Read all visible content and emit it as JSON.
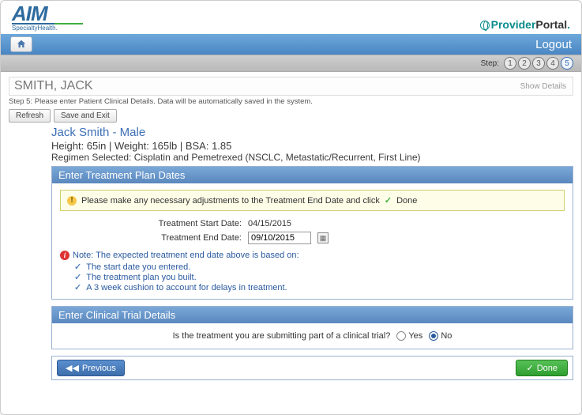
{
  "branding": {
    "aim_main": "AIM",
    "aim_sub": "SpecialtyHealth.",
    "pp_1": "Provider",
    "pp_2": "Portal",
    "pp_dot": "."
  },
  "nav": {
    "logout": "Logout"
  },
  "steps": {
    "label": "Step:",
    "items": [
      "1",
      "2",
      "3",
      "4",
      "5"
    ],
    "active_index": 4
  },
  "patient": {
    "header_name": "SMITH, JACK",
    "show_details": "Show Details",
    "title": "Jack Smith - Male",
    "stats": "Height: 65in  |  Weight: 165lb  |  BSA: 1.85",
    "regimen": "Regimen Selected: Cisplatin and Pemetrexed (NSCLC, Metastatic/Recurrent, First Line)"
  },
  "instruction": "Step 5: Please enter Patient Clinical Details. Data will be automatically saved in the system.",
  "buttons": {
    "refresh": "Refresh",
    "save_exit": "Save and Exit",
    "previous": "Previous",
    "done": "Done"
  },
  "panels": {
    "dates": {
      "header": "Enter Treatment Plan Dates",
      "alert": "Please make any necessary adjustments to the Treatment End Date and click",
      "alert_done": "Done",
      "start_label": "Treatment Start Date:",
      "start_value": "04/15/2015",
      "end_label": "Treatment End Date:",
      "end_value": "09/10/2015",
      "note": "Note: The expected treatment end date above is based on:",
      "bullets": [
        "The start date you entered.",
        "The treatment plan you built.",
        "A 3 week cushion to account for delays in treatment."
      ]
    },
    "trial": {
      "header": "Enter Clinical Trial Details",
      "question": "Is the treatment you are submitting part of a clinical trial?",
      "yes": "Yes",
      "no": "No",
      "selected": "No"
    }
  }
}
